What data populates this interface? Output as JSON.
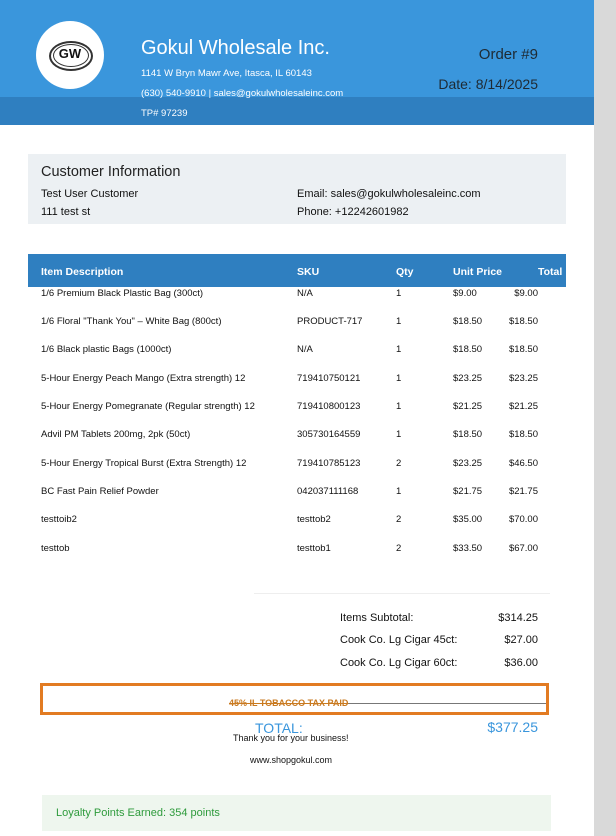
{
  "header": {
    "logo_text": "GW",
    "company": "Gokul Wholesale Inc.",
    "address": "1141 W Bryn Mawr Ave, Itasca, IL 60143",
    "contact": "(630) 540-9910 | sales@gokulwholesaleinc.com",
    "tp": "TP# 97239",
    "order": "Order #9",
    "date": "Date: 8/14/2025",
    "colors": {
      "primary": "#3a96dc",
      "band": "#2f7fc0"
    }
  },
  "customer": {
    "title": "Customer Information",
    "name": "Test User Customer",
    "address": "111 test st",
    "email": "Email: sales@gokulwholesaleinc.com",
    "phone": "Phone: +12242601982"
  },
  "table": {
    "headers": {
      "desc": "Item Description",
      "sku": "SKU",
      "qty": "Qty",
      "price": "Unit Price",
      "total": "Total"
    },
    "rows": [
      {
        "desc": "1/6 Premium Black Plastic Bag (300ct)",
        "sku": "N/A",
        "qty": "1",
        "price": "$9.00",
        "total": "$9.00"
      },
      {
        "desc": "1/6 Floral \"Thank You\" – White Bag (800ct)",
        "sku": "PRODUCT-717",
        "qty": "1",
        "price": "$18.50",
        "total": "$18.50"
      },
      {
        "desc": "1/6 Black plastic Bags (1000ct)",
        "sku": "N/A",
        "qty": "1",
        "price": "$18.50",
        "total": "$18.50"
      },
      {
        "desc": "5-Hour Energy Peach Mango (Extra strength) 12",
        "sku": "719410750121",
        "qty": "1",
        "price": "$23.25",
        "total": "$23.25"
      },
      {
        "desc": "5-Hour Energy Pomegranate (Regular strength) 12",
        "sku": "719410800123",
        "qty": "1",
        "price": "$21.25",
        "total": "$21.25"
      },
      {
        "desc": "Advil PM Tablets 200mg, 2pk (50ct)",
        "sku": "305730164559",
        "qty": "1",
        "price": "$18.50",
        "total": "$18.50"
      },
      {
        "desc": "5-Hour Energy Tropical Burst (Extra Strength) 12",
        "sku": "719410785123",
        "qty": "2",
        "price": "$23.25",
        "total": "$46.50"
      },
      {
        "desc": "BC Fast Pain Relief Powder",
        "sku": "042037111168",
        "qty": "1",
        "price": "$21.75",
        "total": "$21.75"
      },
      {
        "desc": "testtoib2",
        "sku": "testtob2",
        "qty": "2",
        "price": "$35.00",
        "total": "$70.00"
      },
      {
        "desc": "testtob",
        "sku": "testtob1",
        "qty": "2",
        "price": "$33.50",
        "total": "$67.00"
      }
    ]
  },
  "summary": {
    "subtotal_label": "Items Subtotal:",
    "subtotal": "$314.25",
    "cigar45_label": "Cook Co. Lg Cigar 45ct:",
    "cigar45": "$27.00",
    "cigar60_label": "Cook Co. Lg Cigar 60ct:",
    "cigar60": "$36.00",
    "tax_note": "45% IL TOBACCO TAX PAID",
    "total_label": "TOTAL:",
    "total": "$377.25",
    "highlight_color": "#e27b22"
  },
  "footer": {
    "thanks": "Thank you for your business!",
    "website": "www.shopgokul.com",
    "loyalty": "Loyalty Points Earned: 354 points"
  }
}
